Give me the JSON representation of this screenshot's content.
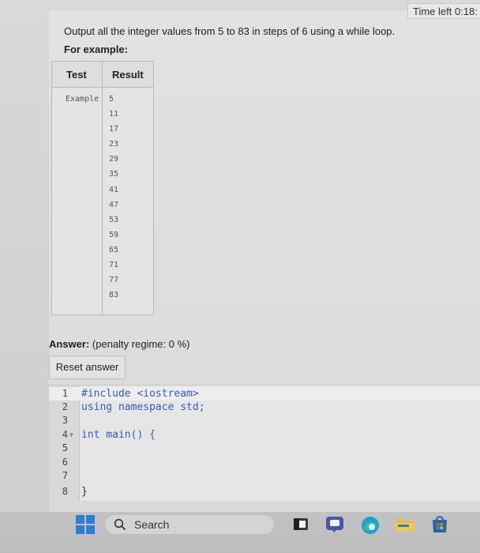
{
  "timer": {
    "label": "Time left 0:18:"
  },
  "question": {
    "text": "Output all the integer values from 5 to 83 in steps of 6 using a while loop.",
    "for_example": "For example:"
  },
  "example_table": {
    "headers": [
      "Test",
      "Result"
    ],
    "test": "Example",
    "result_lines": [
      "5",
      "11",
      "17",
      "23",
      "29",
      "35",
      "41",
      "47",
      "53",
      "59",
      "65",
      "71",
      "77",
      "83"
    ]
  },
  "answer": {
    "label": "Answer:",
    "penalty": "(penalty regime: 0 %)"
  },
  "reset_button": {
    "label": "Reset answer"
  },
  "editor": {
    "lines": [
      {
        "num": "1",
        "text": "#include <iostream>"
      },
      {
        "num": "2",
        "text": "using namespace std;"
      },
      {
        "num": "3",
        "text": ""
      },
      {
        "num": "4",
        "text": "int main() {"
      },
      {
        "num": "5",
        "text": ""
      },
      {
        "num": "6",
        "text": ""
      },
      {
        "num": "7",
        "text": ""
      },
      {
        "num": "8",
        "text": "}"
      }
    ]
  },
  "taskbar": {
    "search_label": "Search",
    "icons": [
      "windows-start-icon",
      "search-icon",
      "file-explorer-icon",
      "teams-chat-icon",
      "edge-browser-icon",
      "folder-icon",
      "microsoft-store-icon"
    ]
  },
  "colors": {
    "keyword": "#3a58c7",
    "page_bg": "#d9d9d9"
  }
}
